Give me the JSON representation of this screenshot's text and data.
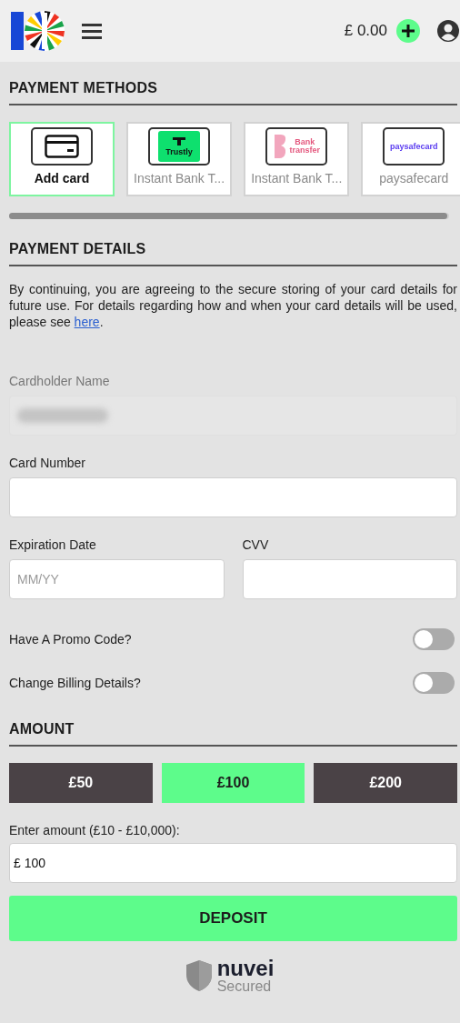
{
  "header": {
    "balance": "£ 0.00"
  },
  "payment_methods": {
    "title": "PAYMENT METHODS",
    "methods": [
      {
        "kind": "card",
        "label": "Add card",
        "selected": true
      },
      {
        "kind": "trustly",
        "label": "Instant Bank T...",
        "logo_text": "Trustly",
        "selected": false
      },
      {
        "kind": "bank",
        "label": "Instant Bank T...",
        "logo_text": "Bank transfer",
        "selected": false
      },
      {
        "kind": "paysafe",
        "label": "paysafecard",
        "logo_text": "paysafecard",
        "selected": false
      }
    ]
  },
  "payment_details": {
    "title": "PAYMENT DETAILS",
    "notice": {
      "text": "By continuing, you are agreeing to the secure storing of your card details for future use. For details regarding how and when your card details will be used, please see ",
      "link": "here",
      "end": "."
    },
    "fields": [
      {
        "label": "Cardholder Name",
        "disabled": true,
        "blurred": true
      },
      {
        "label": "Card Number",
        "disabled": false
      }
    ],
    "split_fields": [
      {
        "label": "Expiration Date",
        "placeholder": "MM/YY"
      },
      {
        "label": "CVV"
      }
    ],
    "toggles": [
      {
        "label": "Have A Promo Code?",
        "on": false
      },
      {
        "label": "Change Billing Details?",
        "on": false
      }
    ]
  },
  "amount": {
    "title": "AMOUNT",
    "presets": [
      {
        "label": "£50",
        "selected": false
      },
      {
        "label": "£100",
        "selected": true
      },
      {
        "label": "£200",
        "selected": false
      }
    ],
    "input_label": "Enter amount (£10 - £10,000):",
    "value": "£ 100",
    "button": "DEPOSIT"
  },
  "footer": {
    "brand": "nuvei",
    "tagline": "Secured"
  }
}
